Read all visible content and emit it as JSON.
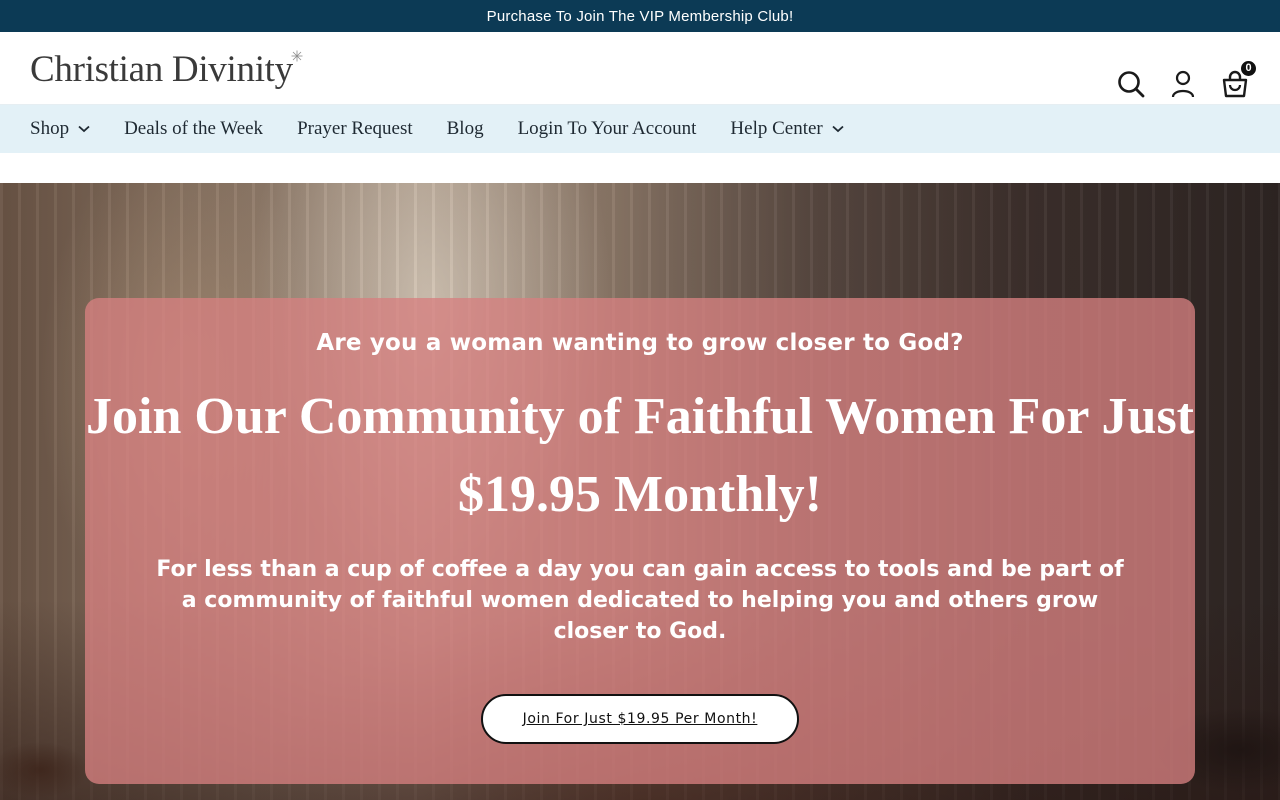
{
  "announcement": {
    "text": "Purchase To Join The VIP Membership Club!"
  },
  "header": {
    "logo_text": "Christian Divinity",
    "search_icon": "search-icon",
    "account_icon": "user-icon",
    "cart_icon": "shopping-bag-icon",
    "cart_count": "0"
  },
  "nav": {
    "items": [
      {
        "label": "Shop",
        "has_dropdown": true
      },
      {
        "label": "Deals of the Week",
        "has_dropdown": false
      },
      {
        "label": "Prayer Request",
        "has_dropdown": false
      },
      {
        "label": "Blog",
        "has_dropdown": false
      },
      {
        "label": "Login To Your Account",
        "has_dropdown": false
      },
      {
        "label": "Help Center",
        "has_dropdown": true
      }
    ]
  },
  "hero": {
    "question": "Are you a woman wanting to grow closer to God?",
    "title": "Join Our Community of Faithful Women For Just $19.95 Monthly!",
    "subtitle": "For less than a cup of coffee a day you can gain access to tools and be part of a community of faithful women dedicated to helping you and others grow closer to God.",
    "cta_label": "Join For Just $19.95 Per Month!"
  },
  "colors": {
    "announcement_bg": "#0c3a55",
    "nav_bg": "#e3f1f7",
    "card_bg": "#d68080",
    "text_dark": "#1f2a33"
  }
}
